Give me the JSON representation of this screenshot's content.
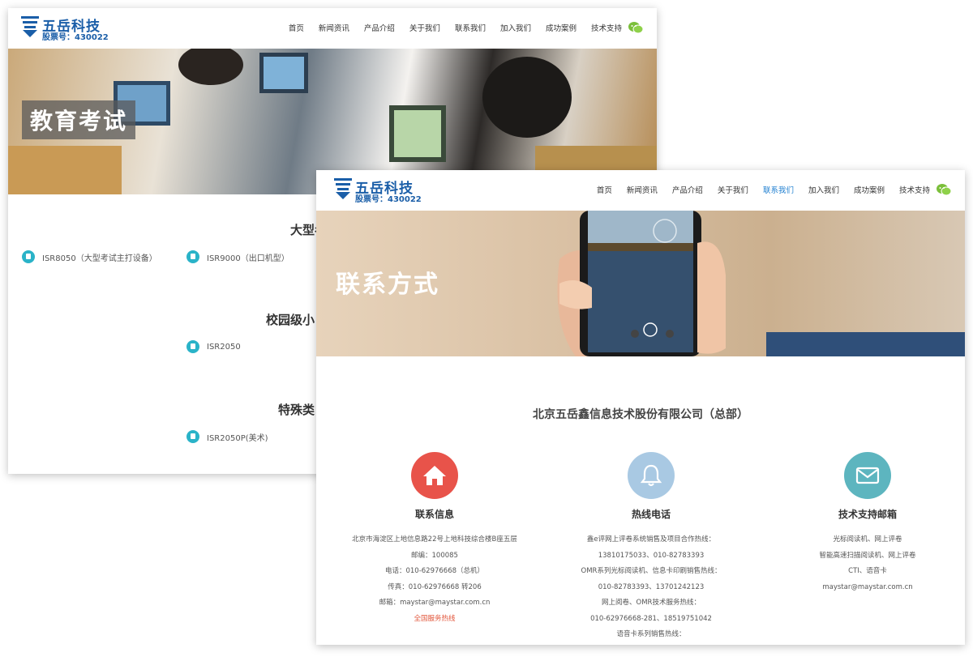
{
  "brand": {
    "name": "五岳科技",
    "stock": "股票号：430022"
  },
  "nav": [
    "首页",
    "新闻资讯",
    "产品介绍",
    "关于我们",
    "联系我们",
    "加入我们",
    "成功案例",
    "技术支持"
  ],
  "back_window": {
    "banner_title": "教育考试",
    "sections": [
      {
        "title": "大型考",
        "products": [
          "ISR8050（大型考试主打设备）",
          "ISR9000（出口机型）"
        ]
      },
      {
        "title": "校园级小",
        "products": [
          "ISR2050"
        ]
      },
      {
        "title": "特殊类",
        "products": [
          "ISR2050P(美术)"
        ]
      }
    ]
  },
  "front_window": {
    "active_nav": "联系我们",
    "banner_title": "联系方式",
    "company": "北京五岳鑫信息技术股份有限公司（总部）",
    "columns": [
      {
        "icon": "home-icon",
        "color": "#e8534a",
        "title": "联系信息",
        "lines": [
          "北京市海淀区上地信息路22号上地科技综合楼B座五层",
          "邮编：100085",
          "电话：010-62976668（总机）",
          "传真：010-62976668 转206",
          "邮箱：maystar@maystar.com.cn"
        ],
        "hotline": "全国服务热线"
      },
      {
        "icon": "bell-icon",
        "color": "#a9c9e3",
        "title": "热线电话",
        "lines": [
          "鑫e评网上评卷系统销售及项目合作热线：",
          "13810175033、010-82783393",
          "OMR系列光标阅读机、信息卡印刷销售热线：",
          "010-82783393、13701242123",
          "网上阅卷、OMR技术服务热线：",
          "010-62976668-281、18519751042",
          "语音卡系列销售热线："
        ]
      },
      {
        "icon": "mail-icon",
        "color": "#5db5bf",
        "title": "技术支持邮箱",
        "lines": [
          "光标阅读机、网上评卷",
          "智能高速扫描阅读机、网上评卷",
          "CTI、语音卡",
          "maystar@maystar.com.cn"
        ]
      }
    ]
  }
}
